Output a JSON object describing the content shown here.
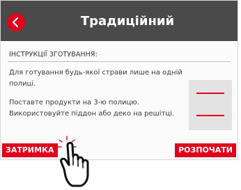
{
  "header": {
    "title": "Традиційний"
  },
  "instructions": {
    "heading": "ІНСТРУКЦІЇ ЗГОТУВАННЯ:",
    "paragraph1": "Для готування будь-якої страви лише на одній полиці.",
    "paragraph2": "Поставте продукти на 3-ю полицю. Використовуйте піддон або деко на решітці."
  },
  "footer": {
    "delay_label": "ЗАТРИМКА",
    "start_label": "РОЗПОЧАТИ"
  },
  "colors": {
    "accent": "#e0001b",
    "header": "#4a4a4a",
    "oven_panel": "#e3e3e3"
  },
  "icons": {
    "back": "chevron-left-icon",
    "oven": "oven-shelf-icon",
    "hand": "hand-pointer-icon"
  }
}
